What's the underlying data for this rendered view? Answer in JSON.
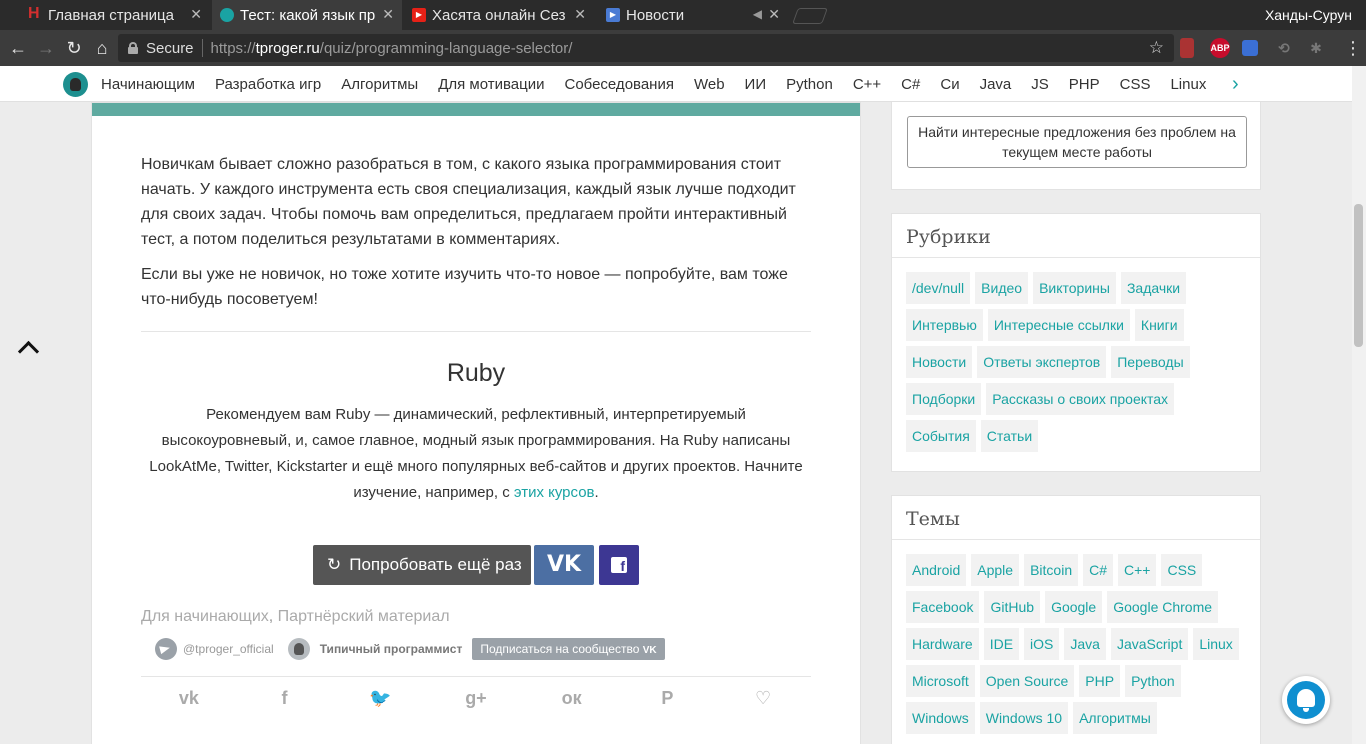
{
  "browser": {
    "tabs": [
      {
        "label": "Главная страница",
        "favicon_color": "#d32f2f",
        "favicon_letter": "H"
      },
      {
        "label": "Тест: какой язык пр",
        "favicon_color": "#1aa3a3",
        "favicon_letter": ""
      },
      {
        "label": "Хасята онлайн Сез",
        "favicon_color": "#e62117",
        "favicon_letter": "▶"
      },
      {
        "label": "Новости",
        "favicon_color": "#4a7bd4",
        "favicon_letter": "▶"
      }
    ],
    "profile_name": "Ханды-Сурун",
    "secure_label": "Secure",
    "url_scheme": "https://",
    "url_host": "tproger.ru",
    "url_path": "/quiz/programming-language-selector/",
    "extensions": [
      {
        "name": "extension-red-icon",
        "label": "",
        "color": "#a33"
      },
      {
        "name": "adblock-plus-icon",
        "label": "ABP",
        "color": "#c70d2c"
      },
      {
        "name": "extension-blue-icon",
        "label": "",
        "color": "#3b6fd4"
      },
      {
        "name": "extension-gray-icon",
        "label": "",
        "color": "#555"
      },
      {
        "name": "extension-paw-icon",
        "label": "",
        "color": "#555"
      }
    ]
  },
  "site_nav": {
    "links": [
      "Начинающим",
      "Разработка игр",
      "Алгоритмы",
      "Для мотивации",
      "Собеседования",
      "Web",
      "ИИ",
      "Python",
      "C++",
      "C#",
      "Си",
      "Java",
      "JS",
      "PHP",
      "CSS",
      "Linux"
    ]
  },
  "article": {
    "intro_p1": "Новичкам бывает сложно разобраться в том, с какого языка программирования стоит начать. У каждого инструмента есть своя специализация, каждый язык лучше подходит для своих задач. Чтобы помочь вам определиться, предлагаем пройти интерактивный тест, а потом поделиться результатами в комментариях.",
    "intro_p2": "Если вы уже не новичок, но тоже хотите изучить что-то новое — попробуйте, вам тоже что-нибудь посоветуем!",
    "result_title": "Ruby",
    "result_desc": "Рекомендуем вам Ruby — динамический, рефлективный, интерпретируемый высокоуровневый, и, самое главное, модный язык программирования. На Ruby написаны LookAtMe, Twitter, Kickstarter и ещё много популярных веб-сайтов и других проектов. Начните изучение, например, с ",
    "result_link": "этих курсов",
    "result_end": ".",
    "retry_label": "Попробовать ещё раз",
    "vk_label": "VK",
    "fb_label": "f",
    "tag1": "Для начинающих",
    "tag_sep": ", ",
    "tag2": "Партнёрский материал",
    "telegram_handle": "@tproger_official",
    "community_name": "Типичный программист",
    "subscribe_label": "Подписаться на сообщество",
    "subscribe_badge": "VK"
  },
  "sidebar": {
    "offer_label": "Найти интересные предложения без проблем на текущем месте работы",
    "rubrics_title": "Рубрики",
    "rubrics": [
      "/dev/null",
      "Видео",
      "Викторины",
      "Задачки",
      "Интервью",
      "Интересные ссылки",
      "Книги",
      "Новости",
      "Ответы экспертов",
      "Переводы",
      "Подборки",
      "Рассказы о своих проектах",
      "События",
      "Статьи"
    ],
    "topics_title": "Темы",
    "topics": [
      "Android",
      "Apple",
      "Bitcoin",
      "C#",
      "C++",
      "CSS",
      "Facebook",
      "GitHub",
      "Google",
      "Google Chrome",
      "Hardware",
      "IDE",
      "iOS",
      "Java",
      "JavaScript",
      "Linux",
      "Microsoft",
      "Open Source",
      "PHP",
      "Python",
      "Windows",
      "Windows 10",
      "Алгоритмы"
    ]
  }
}
